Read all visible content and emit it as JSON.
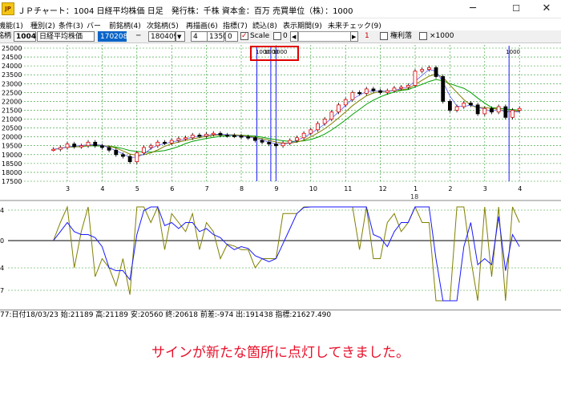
{
  "window": {
    "icon_text": "JP",
    "title": "ＪＰチャート：1004 日経平均株価 日足　発行株：千株 資本金：百万 売買単位（株）：1000",
    "minimize": "─",
    "maximize": "☐",
    "close": "✕"
  },
  "menu": [
    "機能(1)",
    "種別(2)",
    "条件(3)",
    "バー",
    "前銘柄(4)",
    "次銘柄(5)",
    "再描画(6)",
    "指標(7)",
    "読込(8)",
    "表示期間(9)",
    "未来チェック(9)"
  ],
  "toolbar": {
    "code_label": "銘柄",
    "code": "1004",
    "name": "日経平均株価",
    "date_from": "170208",
    "dash": "─",
    "date_to": "180409",
    "dropdown_arrow": "▼",
    "field_a": "4",
    "field_b": "1350",
    "field_c": "0",
    "scale_label": "Scale",
    "scale_value": "0",
    "scroll_left": "◀",
    "scroll_right": "▶",
    "count": "1",
    "adjust_label": "権利落",
    "x1000_label": "×1000"
  },
  "chart_data": {
    "type": "line",
    "title": "",
    "price_axis": {
      "ylim": [
        17500,
        25000
      ],
      "ticks": [
        "25000",
        "24500",
        "24000",
        "23500",
        "23000",
        "22500",
        "22000",
        "21500",
        "21000",
        "20500",
        "20000",
        "19500",
        "19000",
        "18500",
        "18000",
        "17500"
      ]
    },
    "month_labels": [
      "3",
      "4",
      "5",
      "6",
      "7",
      "8",
      "9",
      "10",
      "11",
      "12",
      "1",
      "2",
      "3",
      "4"
    ],
    "year_label": "18",
    "annotations": [
      "1000",
      "1000",
      "1000",
      "1000"
    ],
    "price_series": {
      "name": "",
      "x_months": [
        2.6,
        2.8,
        3.0,
        3.2,
        3.4,
        3.6,
        3.8,
        4.0,
        4.2,
        4.4,
        4.6,
        4.8,
        5.0,
        5.2,
        5.4,
        5.6,
        5.8,
        6.0,
        6.2,
        6.4,
        6.6,
        6.8,
        7.0,
        7.2,
        7.4,
        7.6,
        7.8,
        8.0,
        8.2,
        8.4,
        8.6,
        8.8,
        9.0,
        9.2,
        9.4,
        9.6,
        9.8,
        10.0,
        10.2,
        10.4,
        10.6,
        10.8,
        11.0,
        11.2,
        11.4,
        11.6,
        11.8,
        12.0,
        12.2,
        12.4,
        12.6,
        12.8,
        13.0,
        13.2,
        13.4,
        13.6,
        13.8,
        14.0,
        14.2,
        14.4,
        14.6,
        14.8,
        15.0,
        15.2,
        15.4,
        15.6,
        15.8,
        16.0
      ],
      "values": [
        19300,
        19400,
        19600,
        19450,
        19500,
        19700,
        19500,
        19400,
        19250,
        19000,
        18900,
        18600,
        19100,
        19400,
        19500,
        19700,
        19650,
        19800,
        19900,
        19950,
        20100,
        20050,
        20150,
        20200,
        20100,
        20080,
        20050,
        20000,
        19950,
        19800,
        19700,
        19600,
        19500,
        19650,
        19800,
        19950,
        20200,
        20400,
        20750,
        21000,
        21400,
        21800,
        22100,
        22500,
        22450,
        22700,
        22600,
        22500,
        22600,
        22750,
        22800,
        22900,
        23700,
        23800,
        23900,
        23400,
        22000,
        21500,
        21700,
        21900,
        21800,
        21300,
        21600,
        21400,
        21700,
        21100,
        21500,
        21600
      ]
    },
    "oscillator": {
      "ticks": [
        "4",
        "0",
        "4",
        "7"
      ]
    }
  },
  "status": {
    "text": "77:日付18/03/23 始:21189 高:21189 安:20560 終:20618 前差:-974 出:191438 指標:21627.490"
  },
  "caption": "サインが新たな箇所に点灯してきました。",
  "colors": {
    "price_line": "#000000",
    "ma_short": "#1a1aff",
    "ma_mid": "#808000",
    "ma_long": "#00a000",
    "signal_line": "#1a1aff",
    "highlight": "#e00000",
    "caption": "#e8102a"
  }
}
